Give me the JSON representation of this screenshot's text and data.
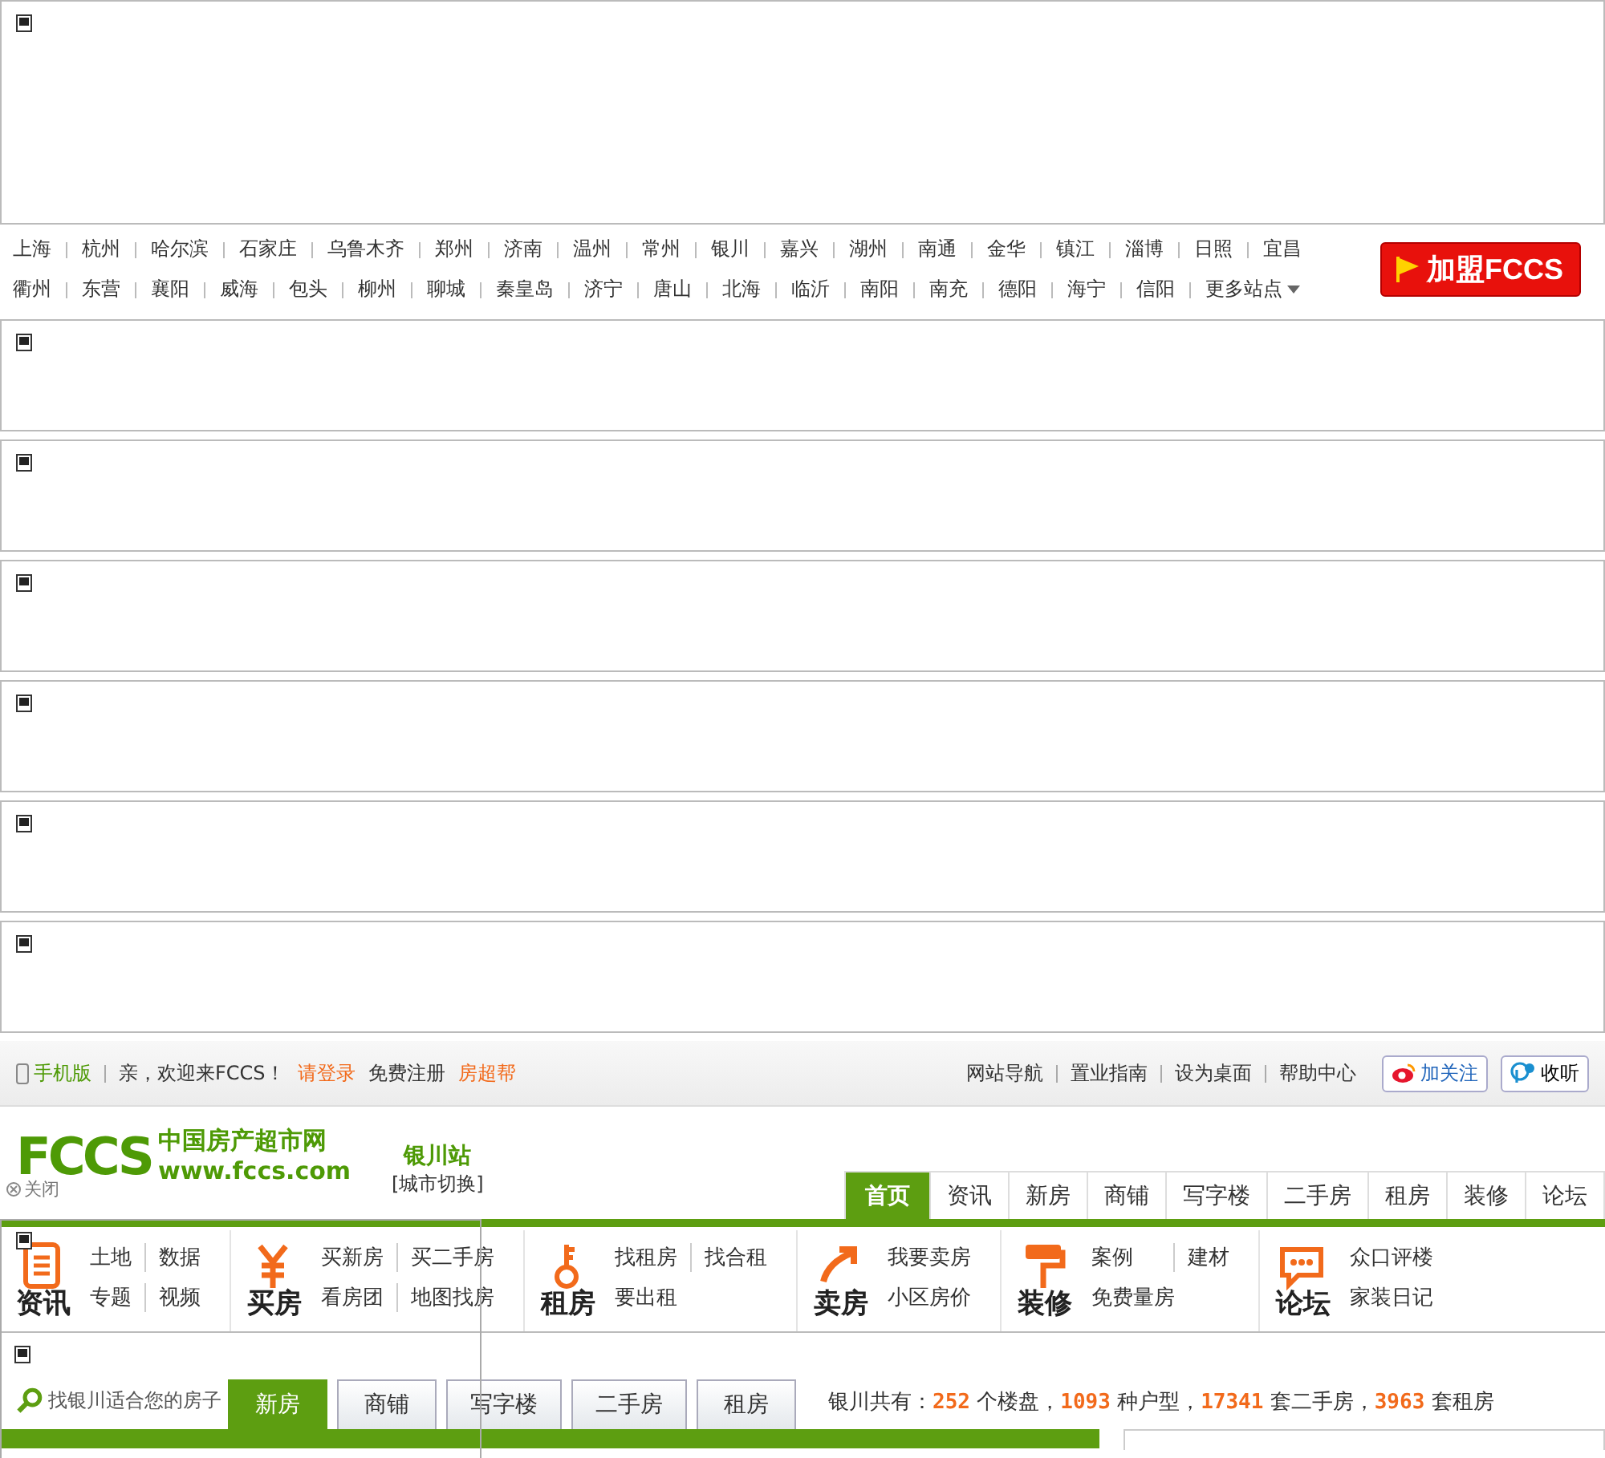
{
  "cities": [
    [
      "上海",
      "杭州",
      "哈尔滨",
      "石家庄",
      "乌鲁木齐",
      "郑州",
      "济南",
      "温州",
      "常州",
      "银川",
      "嘉兴",
      "湖州",
      "南通",
      "金华",
      "镇江",
      "淄博",
      "日照",
      "宜昌"
    ],
    [
      "衢州",
      "东营",
      "襄阳",
      "威海",
      "包头",
      "柳州",
      "聊城",
      "秦皇岛",
      "济宁",
      "唐山",
      "北海",
      "临沂",
      "南阳",
      "南充",
      "德阳",
      "海宁",
      "信阳"
    ]
  ],
  "more_sites": "更多站点",
  "join_button": "加盟FCCS",
  "top_bar": {
    "mobile": "手机版",
    "welcome": "亲，欢迎来FCCS！",
    "login": "请登录",
    "register": "免费注册",
    "helper": "房超帮",
    "links": [
      "网站导航",
      "置业指南",
      "设为桌面",
      "帮助中心"
    ],
    "follow": "加关注",
    "listen": "收听"
  },
  "logo": {
    "mark": "FCCS",
    "name": "中国房产超市网",
    "url": "www.fccs.com"
  },
  "station": "银川站",
  "switch_city": "[城市切换]",
  "close": "关闭",
  "nav": [
    {
      "label": "首页",
      "selected": true
    },
    {
      "label": "资讯",
      "selected": false
    },
    {
      "label": "新房",
      "selected": false
    },
    {
      "label": "商铺",
      "selected": false
    },
    {
      "label": "写字楼",
      "selected": false
    },
    {
      "label": "二手房",
      "selected": false
    },
    {
      "label": "租房",
      "selected": false
    },
    {
      "label": "装修",
      "selected": false
    },
    {
      "label": "论坛",
      "selected": false
    }
  ],
  "categories": [
    {
      "kind": "news",
      "title": "资讯",
      "links": [
        "土地",
        "数据",
        "专题",
        "视频"
      ]
    },
    {
      "kind": "buy",
      "title": "买房",
      "links": [
        "买新房",
        "买二手房",
        "看房团",
        "地图找房"
      ]
    },
    {
      "kind": "rent",
      "title": "租房",
      "links": [
        "找租房",
        "找合租",
        "要出租"
      ]
    },
    {
      "kind": "sell",
      "title": "卖房",
      "links": [
        "我要卖房",
        "小区房价"
      ]
    },
    {
      "kind": "decor",
      "title": "装修",
      "links": [
        "案例",
        "建材",
        "免费量房"
      ]
    },
    {
      "kind": "forum",
      "title": "论坛",
      "links": [
        "众口评楼",
        "家装日记"
      ]
    }
  ],
  "search": {
    "placeholder": "找银川适合您的房子",
    "tabs": [
      {
        "label": "新房",
        "selected": true
      },
      {
        "label": "商铺",
        "selected": false
      },
      {
        "label": "写字楼",
        "selected": false
      },
      {
        "label": "二手房",
        "selected": false
      },
      {
        "label": "租房",
        "selected": false
      }
    ]
  },
  "stats": "银川共有：**252** 个楼盘，**1093** 种户型，**17341** 套二手房，**3963** 套租房"
}
